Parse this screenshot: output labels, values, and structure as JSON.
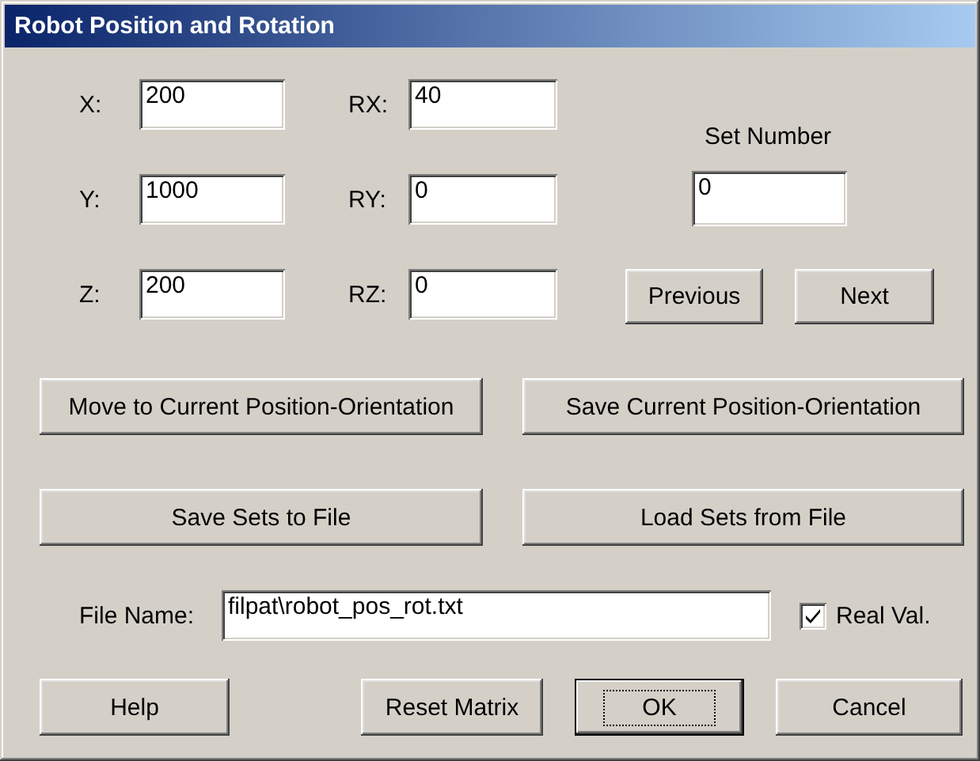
{
  "window": {
    "title": "Robot Position and Rotation"
  },
  "positions": [
    {
      "label": "X:",
      "value": "200"
    },
    {
      "label": "Y:",
      "value": "1000"
    },
    {
      "label": "Z:",
      "value": "200"
    }
  ],
  "rotations": [
    {
      "label": "RX:",
      "value": "40"
    },
    {
      "label": "RY:",
      "value": "0"
    },
    {
      "label": "RZ:",
      "value": "0"
    }
  ],
  "set_number": {
    "label": "Set Number",
    "value": "0"
  },
  "nav_buttons": [
    "Previous",
    "Next"
  ],
  "action_buttons": [
    "Move to Current Position-Orientation",
    "Save Current Position-Orientation",
    "Save Sets to File",
    "Load Sets from File"
  ],
  "file_name": {
    "label": "File Name:",
    "value": "filpat\\robot_pos_rot.txt"
  },
  "real_values": {
    "label": "Real Val.",
    "checked": true
  },
  "buttons": [
    {
      "label": "Help",
      "focused": false
    },
    {
      "label": "Reset Matrix",
      "focused": false
    },
    {
      "label": "OK",
      "focused": true
    },
    {
      "label": "Cancel",
      "focused": false
    }
  ]
}
